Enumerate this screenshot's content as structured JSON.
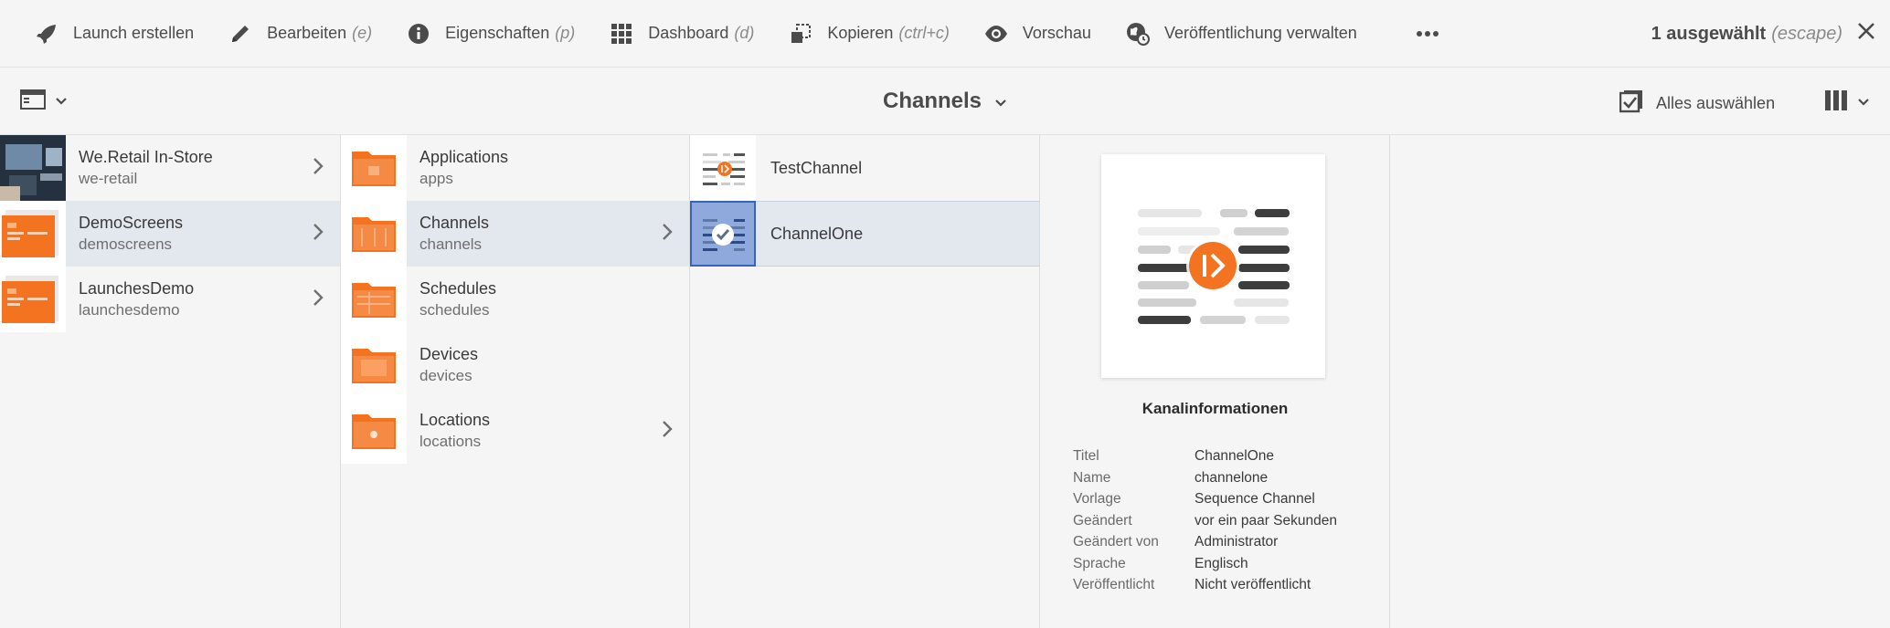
{
  "actionbar": {
    "items": [
      {
        "label": "Launch erstellen",
        "hint": "",
        "icon": "rocket-icon"
      },
      {
        "label": "Bearbeiten",
        "hint": "(e)",
        "icon": "pencil-icon"
      },
      {
        "label": "Eigenschaften",
        "hint": "(p)",
        "icon": "info-icon"
      },
      {
        "label": "Dashboard",
        "hint": "(d)",
        "icon": "grid-icon"
      },
      {
        "label": "Kopieren",
        "hint": "(ctrl+c)",
        "icon": "copy-icon"
      },
      {
        "label": "Vorschau",
        "hint": "",
        "icon": "eye-icon"
      },
      {
        "label": "Veröffentlichung verwalten",
        "hint": "",
        "icon": "globe-clock-icon"
      }
    ],
    "more_icon": "more-icon",
    "selection_count": "1 ausgewählt",
    "selection_hint": "(escape)",
    "close_icon": "close-icon"
  },
  "toolbar": {
    "view_title": "Channels",
    "select_all_label": "Alles auswählen",
    "rail_icon": "rail-toggle-icon",
    "view_switch_icon": "column-view-icon"
  },
  "columns": [
    {
      "items": [
        {
          "title": "We.Retail In-Store",
          "subtitle": "we-retail",
          "has_children": true,
          "state": "normal",
          "thumb": "photo"
        },
        {
          "title": "DemoScreens",
          "subtitle": "demoscreens",
          "has_children": true,
          "state": "active",
          "thumb": "orange"
        },
        {
          "title": "LaunchesDemo",
          "subtitle": "launchesdemo",
          "has_children": true,
          "state": "normal",
          "thumb": "orange"
        }
      ]
    },
    {
      "items": [
        {
          "title": "Applications",
          "subtitle": "apps",
          "has_children": false,
          "state": "normal"
        },
        {
          "title": "Channels",
          "subtitle": "channels",
          "has_children": true,
          "state": "active"
        },
        {
          "title": "Schedules",
          "subtitle": "schedules",
          "has_children": false,
          "state": "normal"
        },
        {
          "title": "Devices",
          "subtitle": "devices",
          "has_children": false,
          "state": "normal"
        },
        {
          "title": "Locations",
          "subtitle": "locations",
          "has_children": true,
          "state": "normal"
        }
      ]
    },
    {
      "items": [
        {
          "title": "TestChannel",
          "state": "normal"
        },
        {
          "title": "ChannelOne",
          "state": "selected"
        }
      ]
    }
  ],
  "details": {
    "heading": "Kanalinformationen",
    "fields": [
      {
        "key": "Titel",
        "value": "ChannelOne"
      },
      {
        "key": "Name",
        "value": "channelone"
      },
      {
        "key": "Vorlage",
        "value": "Sequence Channel"
      },
      {
        "key": "Geändert",
        "value": "vor ein paar Sekunden"
      },
      {
        "key": "Geändert von",
        "value": "Administrator"
      },
      {
        "key": "Sprache",
        "value": "Englisch"
      },
      {
        "key": "Veröffentlicht",
        "value": "Nicht veröffentlicht"
      }
    ]
  },
  "colors": {
    "accent_orange": "#f37321",
    "selection_blue": "#3a62b8",
    "active_row": "#e3e7ee"
  }
}
